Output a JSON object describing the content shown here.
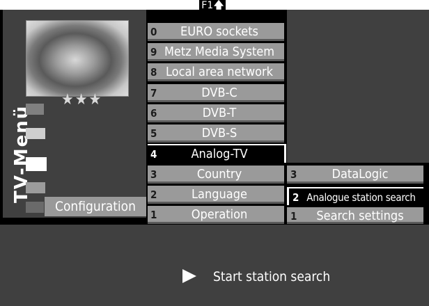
{
  "hotkey": {
    "label": "F1",
    "arrow": "🡅"
  },
  "sidebar": {
    "title": "TV-Menü",
    "rating_stars": "★★★",
    "active_label": "Configuration"
  },
  "menu": {
    "items": [
      {
        "num": "0",
        "label": "EURO sockets"
      },
      {
        "num": "9",
        "label": "Metz Media System"
      },
      {
        "num": "8",
        "label": "Local area network"
      },
      {
        "num": "7",
        "label": "DVB-C"
      },
      {
        "num": "6",
        "label": "DVB-T"
      },
      {
        "num": "5",
        "label": "DVB-S"
      },
      {
        "num": "4",
        "label": "Analog-TV"
      },
      {
        "num": "3",
        "label": "Country"
      },
      {
        "num": "2",
        "label": "Language"
      },
      {
        "num": "1",
        "label": "Operation"
      }
    ]
  },
  "submenu": {
    "items": [
      {
        "num": "3",
        "label": "DataLogic"
      },
      {
        "num": "2",
        "label": "Analogue station search"
      },
      {
        "num": "1",
        "label": "Search settings"
      }
    ]
  },
  "action": {
    "label": "Start station search"
  }
}
